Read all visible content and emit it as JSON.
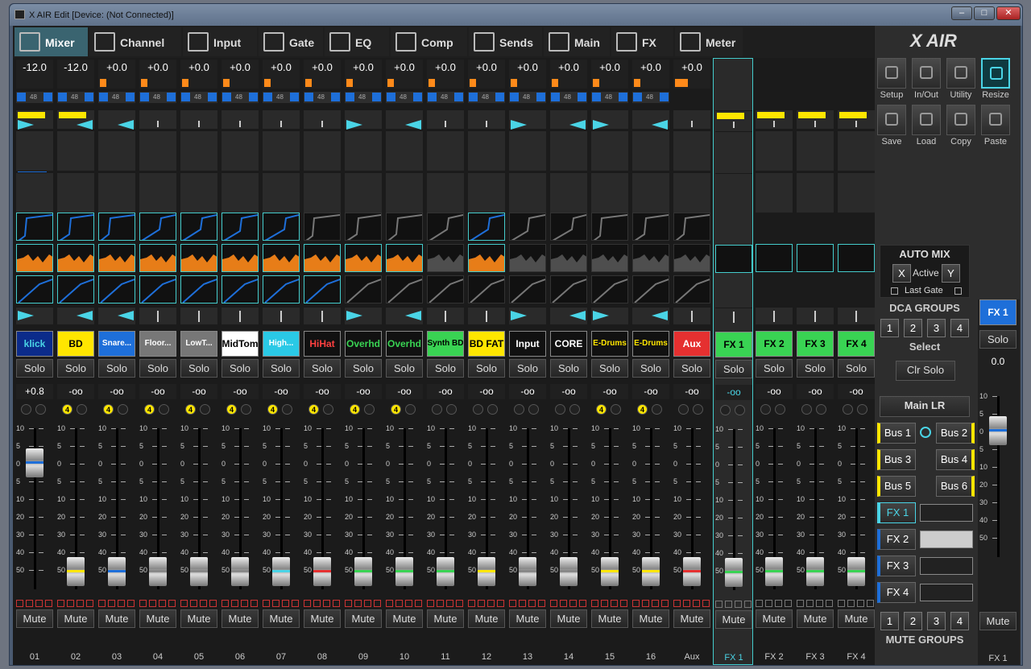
{
  "window": {
    "title": "X AIR Edit [Device: (Not Connected)]"
  },
  "tabs": [
    {
      "label": "Mixer",
      "icon": "mixer-icon"
    },
    {
      "label": "Channel",
      "icon": "channel-icon"
    },
    {
      "label": "Input",
      "icon": "input-icon"
    },
    {
      "label": "Gate",
      "icon": "gate-icon"
    },
    {
      "label": "EQ",
      "icon": "eq-icon"
    },
    {
      "label": "Comp",
      "icon": "comp-icon"
    },
    {
      "label": "Sends",
      "icon": "sends-icon"
    },
    {
      "label": "Main",
      "icon": "main-icon"
    },
    {
      "label": "FX",
      "icon": "fx-icon"
    },
    {
      "label": "Meter",
      "icon": "meter-icon"
    }
  ],
  "colors": {
    "accent": "#4ad4e6",
    "selected_tab": "#3a6470",
    "meter_orange": "#ff8a1a",
    "blue": "#1e6fd9",
    "yellow": "#ffe600",
    "green": "#39d353",
    "red": "#e53030"
  },
  "strips": [
    {
      "gain": "-12.0",
      "name": "klick",
      "fg": "#4ad4e6",
      "bg": "#0b2b8a",
      "solo": "Solo",
      "fader": "+0.8",
      "mute": "Mute",
      "num": "01",
      "pan": "right",
      "cap": "#1e6fd9"
    },
    {
      "gain": "-12.0",
      "name": "BD",
      "fg": "#000",
      "bg": "#ffe600",
      "solo": "Solo",
      "fader": "-oo",
      "mute": "Mute",
      "num": "02",
      "pan": "left",
      "cap": "#ffe600"
    },
    {
      "gain": "+0.0",
      "name": "Snare...",
      "fg": "#fff",
      "bg": "#1e6fd9",
      "solo": "Solo",
      "fader": "-oo",
      "mute": "Mute",
      "num": "03",
      "pan": "left",
      "cap": "#1e6fd9"
    },
    {
      "gain": "+0.0",
      "name": "Floor...",
      "fg": "#fff",
      "bg": "#777",
      "solo": "Solo",
      "fader": "-oo",
      "mute": "Mute",
      "num": "04",
      "pan": "center",
      "cap": "#888"
    },
    {
      "gain": "+0.0",
      "name": "LowT...",
      "fg": "#fff",
      "bg": "#777",
      "solo": "Solo",
      "fader": "-oo",
      "mute": "Mute",
      "num": "05",
      "pan": "center",
      "cap": "#888"
    },
    {
      "gain": "+0.0",
      "name": "MidTom",
      "fg": "#000",
      "bg": "#fff",
      "solo": "Solo",
      "fader": "-oo",
      "mute": "Mute",
      "num": "06",
      "pan": "center",
      "cap": "#888"
    },
    {
      "gain": "+0.0",
      "name": "High...",
      "fg": "#fff",
      "bg": "#2ac9e6",
      "solo": "Solo",
      "fader": "-oo",
      "mute": "Mute",
      "num": "07",
      "pan": "center",
      "cap": "#4ad4e6"
    },
    {
      "gain": "+0.0",
      "name": "HiHat",
      "fg": "#ff4040",
      "bg": "#111",
      "solo": "Solo",
      "fader": "-oo",
      "mute": "Mute",
      "num": "08",
      "pan": "center",
      "cap": "#e53030"
    },
    {
      "gain": "+0.0",
      "name": "Overhd",
      "fg": "#39d353",
      "bg": "#111",
      "solo": "Solo",
      "fader": "-oo",
      "mute": "Mute",
      "num": "09",
      "pan": "right",
      "cap": "#39d353"
    },
    {
      "gain": "+0.0",
      "name": "Overhd",
      "fg": "#39d353",
      "bg": "#111",
      "solo": "Solo",
      "fader": "-oo",
      "mute": "Mute",
      "num": "10",
      "pan": "left",
      "cap": "#39d353"
    },
    {
      "gain": "+0.0",
      "name": "Synth BD",
      "fg": "#000",
      "bg": "#39d353",
      "solo": "Solo",
      "fader": "-oo",
      "mute": "Mute",
      "num": "11",
      "pan": "center",
      "cap": "#39d353"
    },
    {
      "gain": "+0.0",
      "name": "BD FAT",
      "fg": "#000",
      "bg": "#ffe600",
      "solo": "Solo",
      "fader": "-oo",
      "mute": "Mute",
      "num": "12",
      "pan": "center",
      "cap": "#ffe600"
    },
    {
      "gain": "+0.0",
      "name": "Input",
      "fg": "#fff",
      "bg": "#111",
      "solo": "Solo",
      "fader": "-oo",
      "mute": "Mute",
      "num": "13",
      "pan": "right",
      "cap": "#888"
    },
    {
      "gain": "+0.0",
      "name": "CORE",
      "fg": "#fff",
      "bg": "#111",
      "solo": "Solo",
      "fader": "-oo",
      "mute": "Mute",
      "num": "14",
      "pan": "left",
      "cap": "#888"
    },
    {
      "gain": "+0.0",
      "name": "E-Drums",
      "fg": "#ffe600",
      "bg": "#111",
      "solo": "Solo",
      "fader": "-oo",
      "mute": "Mute",
      "num": "15",
      "pan": "right",
      "cap": "#ffe600"
    },
    {
      "gain": "+0.0",
      "name": "E-Drums",
      "fg": "#ffe600",
      "bg": "#111",
      "solo": "Solo",
      "fader": "-oo",
      "mute": "Mute",
      "num": "16",
      "pan": "left",
      "cap": "#ffe600"
    },
    {
      "gain": "+0.0",
      "name": "Aux",
      "fg": "#fff",
      "bg": "#e53030",
      "solo": "Solo",
      "fader": "-oo",
      "mute": "Mute",
      "num": "Aux",
      "pan": "center",
      "cap": "#e53030"
    },
    {
      "gain": "",
      "name": "FX 1",
      "fg": "#000",
      "bg": "#39d353",
      "solo": "Solo",
      "fader": "-oo",
      "mute": "Mute",
      "num": "FX 1",
      "pan": "center",
      "cap": "#39d353"
    },
    {
      "gain": "",
      "name": "FX 2",
      "fg": "#000",
      "bg": "#39d353",
      "solo": "Solo",
      "fader": "-oo",
      "mute": "Mute",
      "num": "FX 2",
      "pan": "center",
      "cap": "#39d353"
    },
    {
      "gain": "",
      "name": "FX 3",
      "fg": "#000",
      "bg": "#39d353",
      "solo": "Solo",
      "fader": "-oo",
      "mute": "Mute",
      "num": "FX 3",
      "pan": "center",
      "cap": "#39d353"
    },
    {
      "gain": "",
      "name": "FX 4",
      "fg": "#000",
      "bg": "#39d353",
      "solo": "Solo",
      "fader": "-oo",
      "mute": "Mute",
      "num": "FX 4",
      "pan": "center",
      "cap": "#39d353"
    }
  ],
  "fader_scale": [
    "10",
    "5",
    "0",
    "5",
    "10",
    "20",
    "30",
    "40",
    "50"
  ],
  "link_label": "48",
  "side": {
    "logo": "X AIR",
    "tools": [
      {
        "label": "Setup",
        "icon": "gears-icon"
      },
      {
        "label": "In/Out",
        "icon": "in-out-icon"
      },
      {
        "label": "Utility",
        "icon": "wrench-icon"
      },
      {
        "label": "Resize",
        "icon": "resize-icon"
      },
      {
        "label": "Save",
        "icon": "save-icon"
      },
      {
        "label": "Load",
        "icon": "folder-icon"
      },
      {
        "label": "Copy",
        "icon": "copy-icon"
      },
      {
        "label": "Paste",
        "icon": "paste-icon"
      }
    ],
    "automix": {
      "title": "AUTO MIX",
      "x": "X",
      "active": "Active",
      "y": "Y",
      "last_gate": "Last Gate"
    },
    "dca": {
      "title": "DCA GROUPS",
      "buttons": [
        "1",
        "2",
        "3",
        "4"
      ],
      "select": "Select",
      "clr_solo": "Clr Solo"
    },
    "main_lr": "Main LR",
    "buses": [
      "Bus 1",
      "Bus 2",
      "Bus 3",
      "Bus 4",
      "Bus 5",
      "Bus 6"
    ],
    "fx": [
      "FX 1",
      "FX 2",
      "FX 3",
      "FX 4"
    ],
    "mute_groups": {
      "title": "MUTE GROUPS",
      "buttons": [
        "1",
        "2",
        "3",
        "4"
      ]
    }
  },
  "master": {
    "name": "FX 1",
    "solo": "Solo",
    "fader": "0.0",
    "mute": "Mute",
    "num": "FX 1"
  }
}
